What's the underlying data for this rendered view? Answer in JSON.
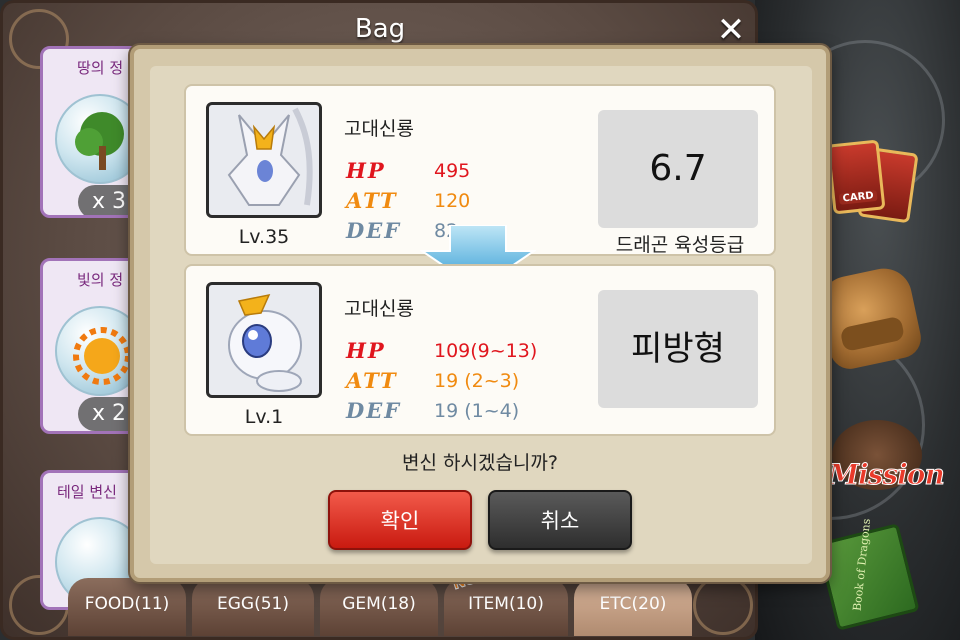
{
  "bag": {
    "title": "Bag",
    "close_label": "✕",
    "items": [
      {
        "name": "땅의 정",
        "qty": "x 3"
      },
      {
        "name": "빛의 정",
        "qty": "x 2"
      },
      {
        "name": "테일 변신"
      }
    ],
    "tabs": [
      {
        "label": "FOOD(11)"
      },
      {
        "label": "EGG(51)"
      },
      {
        "label": "GEM(18)"
      },
      {
        "label": "ITEM(10)"
      },
      {
        "label": "ETC(20)"
      }
    ],
    "new_badge": "New"
  },
  "side_menu": {
    "card_label": "CARD",
    "mission_label": "Mission",
    "book_label": "Book of Dragons"
  },
  "dialog": {
    "current": {
      "name": "고대신룡",
      "level": "Lv.35",
      "hp_label": "HP",
      "hp": "495",
      "att_label": "ATT",
      "att": "120",
      "def_label": "DEF",
      "def": "82",
      "grade_value": "6.7",
      "grade_caption": "드래곤 육성등급"
    },
    "after": {
      "name": "고대신룡",
      "level": "Lv.1",
      "hp_label": "HP",
      "hp": "109(9~13)",
      "att_label": "ATT",
      "att": "19  (2~3)",
      "def_label": "DEF",
      "def": "19  (1~4)",
      "type": "피방형"
    },
    "question": "변신 하시겠습니까?",
    "confirm_label": "확인",
    "cancel_label": "취소"
  },
  "colors": {
    "hp": "#e0161e",
    "att": "#f08a10",
    "def": "#6f8aa2",
    "confirm": "#d9261a",
    "cancel": "#3e3e3e"
  }
}
